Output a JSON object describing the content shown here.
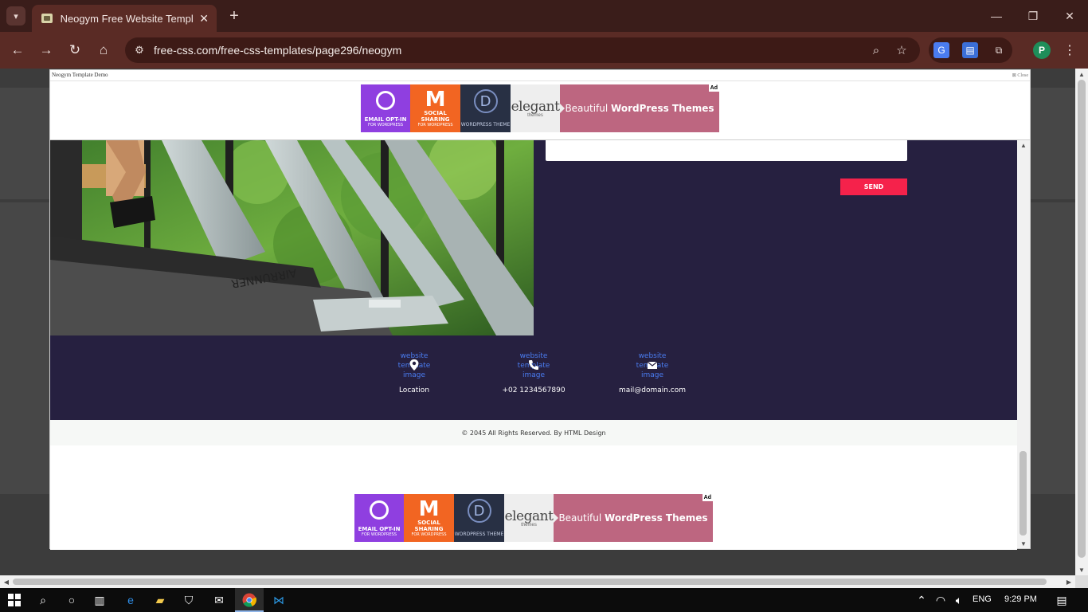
{
  "browser": {
    "tab_title": "Neogym Free Website Template",
    "url": "free-css.com/free-css-templates/page296/neogym",
    "profile_initial": "P"
  },
  "demo": {
    "title": "Neogym Template Demo",
    "close_label": "Close"
  },
  "ad": {
    "tile1_title": "EMAIL OPT-IN",
    "tile1_sub": "FOR WORDPRESS",
    "tile2_title": "SOCIAL SHARING",
    "tile2_sub": "FOR WORDPRESS",
    "tile3_logo": "D",
    "tile3_text": "WORDPRESS THEME",
    "tile4_main": "elegant",
    "tile4_sub": "themes",
    "cta_light": "Beautiful ",
    "cta_bold": "WordPress Themes",
    "badge": "Ad"
  },
  "contact": {
    "send_label": "SEND"
  },
  "footer": {
    "img_alt": "website template image",
    "items": [
      {
        "label": "Location",
        "icon": "map-pin-icon"
      },
      {
        "label": "+02 1234567890",
        "icon": "phone-icon"
      },
      {
        "label": "mail@domain.com",
        "icon": "envelope-icon"
      }
    ],
    "copyright": "© 2045 All Rights Reserved. By HTML Design"
  },
  "taskbar": {
    "language": "ENG",
    "time": "9:29 PM"
  },
  "colors": {
    "chrome_dark": "#3a1d1a",
    "chrome_toolbar": "#5a2b25",
    "panel_navy": "#262040",
    "send_red": "#f5224b",
    "ad_pink": "#bd6680"
  }
}
